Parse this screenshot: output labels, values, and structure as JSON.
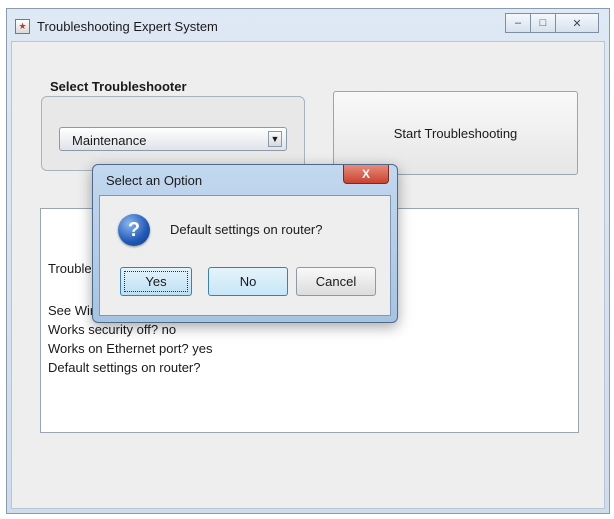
{
  "window": {
    "title": "Troubleshooting Expert System",
    "controls": {
      "minimize": "–",
      "maximize": "□",
      "close": "✕"
    }
  },
  "panel": {
    "group_title": "Select Troubleshooter",
    "select_value": "Maintenance",
    "select_arrow": "▼",
    "start_button": "Start Troubleshooting"
  },
  "log": {
    "lines": [
      "Troubleshooting",
      "See Wireless network? yes",
      "Works security off? no",
      "Works on Ethernet port? yes",
      "Default settings on router?"
    ]
  },
  "dialog": {
    "title": "Select an Option",
    "close_glyph": "X",
    "icon_glyph": "?",
    "message": "Default settings on router?",
    "buttons": {
      "yes": "Yes",
      "no": "No",
      "cancel": "Cancel"
    }
  }
}
